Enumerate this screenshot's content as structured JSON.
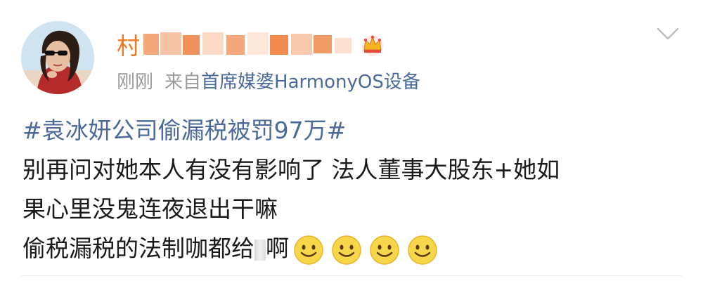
{
  "post": {
    "author": {
      "name_visible": "村",
      "name_color": "#f0781e",
      "avatar_icon": "avatar-photo-icon",
      "badge_icon": "crown-icon"
    },
    "meta": {
      "time": "刚刚",
      "source_prefix": "来自",
      "source_name": "首席媒婆",
      "device": "HarmonyOS设备"
    },
    "menu_icon": "chevron-down-icon",
    "hashtag": "#袁冰妍公司偷漏税被罚97万#",
    "text_line_1": "别再问对她本人有没有影响了 法人董事大股东+她如",
    "text_line_2": "果心里没鬼连夜退出干嘛",
    "text_line_3_part_1": "偷税漏税的法制咖都给",
    "text_line_3_part_2": "啊",
    "emojis": [
      "smile-icon",
      "smile-icon",
      "smile-icon",
      "smile-icon"
    ],
    "colors": {
      "link": "#4b6a9a",
      "meta": "#9a9a9a",
      "text": "#1a1a1a"
    }
  }
}
